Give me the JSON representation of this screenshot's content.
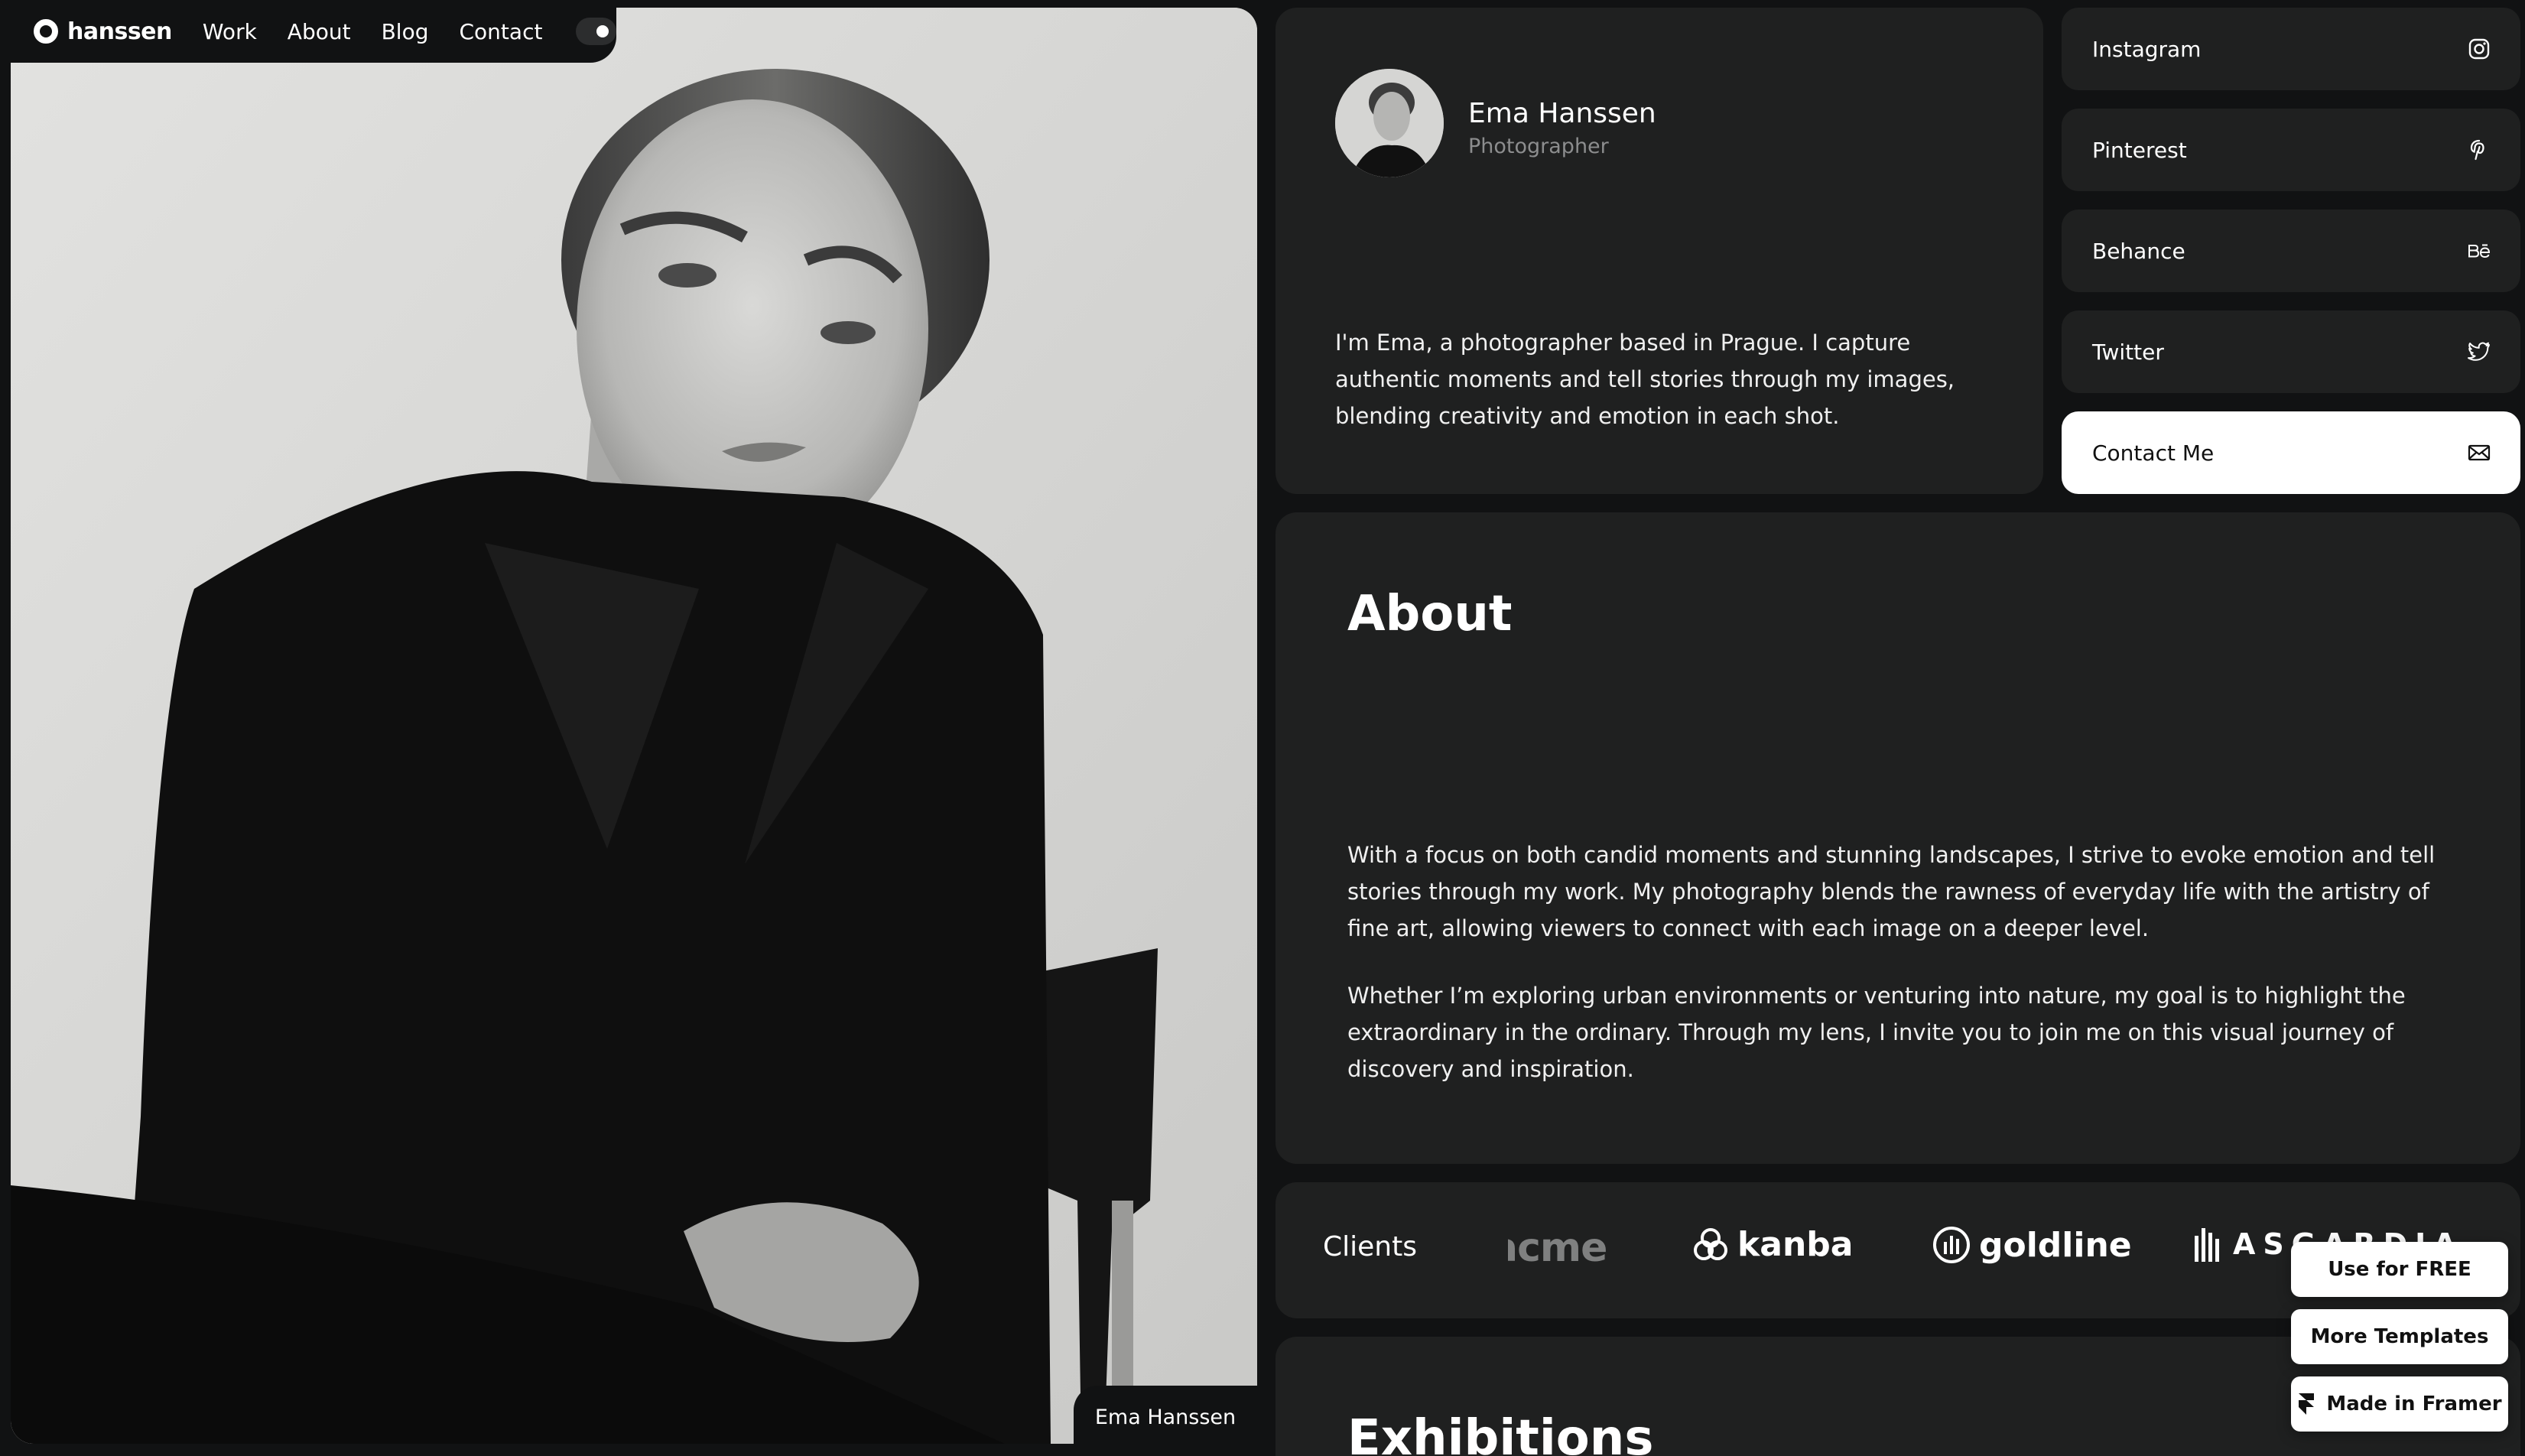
{
  "nav": {
    "logo_text": "hanssen",
    "links": [
      "Work",
      "About",
      "Blog",
      "Contact"
    ]
  },
  "photo": {
    "caption": "Ema Hanssen"
  },
  "profile": {
    "name": "Ema Hanssen",
    "role": "Photographer",
    "bio": "I'm Ema, a photographer based in Prague. I capture authentic moments and tell stories through my images, blending creativity and emotion in each shot."
  },
  "social": [
    {
      "label": "Instagram",
      "icon": "instagram-icon"
    },
    {
      "label": "Pinterest",
      "icon": "pinterest-icon"
    },
    {
      "label": "Behance",
      "icon": "behance-icon"
    },
    {
      "label": "Twitter",
      "icon": "twitter-icon"
    },
    {
      "label": "Contact Me",
      "icon": "mail-icon"
    }
  ],
  "about": {
    "title": "About",
    "paragraphs": [
      "With a focus on both candid moments and stunning landscapes, I strive to evoke emotion and tell stories through my work. My photography blends the rawness of everyday life with the artistry of fine art, allowing viewers to connect with each image on a deeper level.",
      "Whether I’m exploring urban environments or venturing into nature, my goal is to highlight the extraordinary in the ordinary. Through my lens, I invite you to join me on this visual journey of discovery and inspiration."
    ]
  },
  "clients": {
    "label": "Clients",
    "logos": [
      "acme",
      "kanba",
      "goldline",
      "ASGARDIA"
    ]
  },
  "exhibitions": {
    "title": "Exhibitions"
  },
  "framer": {
    "use_free": "Use for FREE",
    "more_templates": "More Templates",
    "made_in": "Made in Framer"
  },
  "colors": {
    "page_bg": "#111213",
    "card_bg": "#1f2020",
    "text_primary": "#ffffff",
    "text_muted": "#8c8d8e",
    "button_light": "#ffffff"
  }
}
